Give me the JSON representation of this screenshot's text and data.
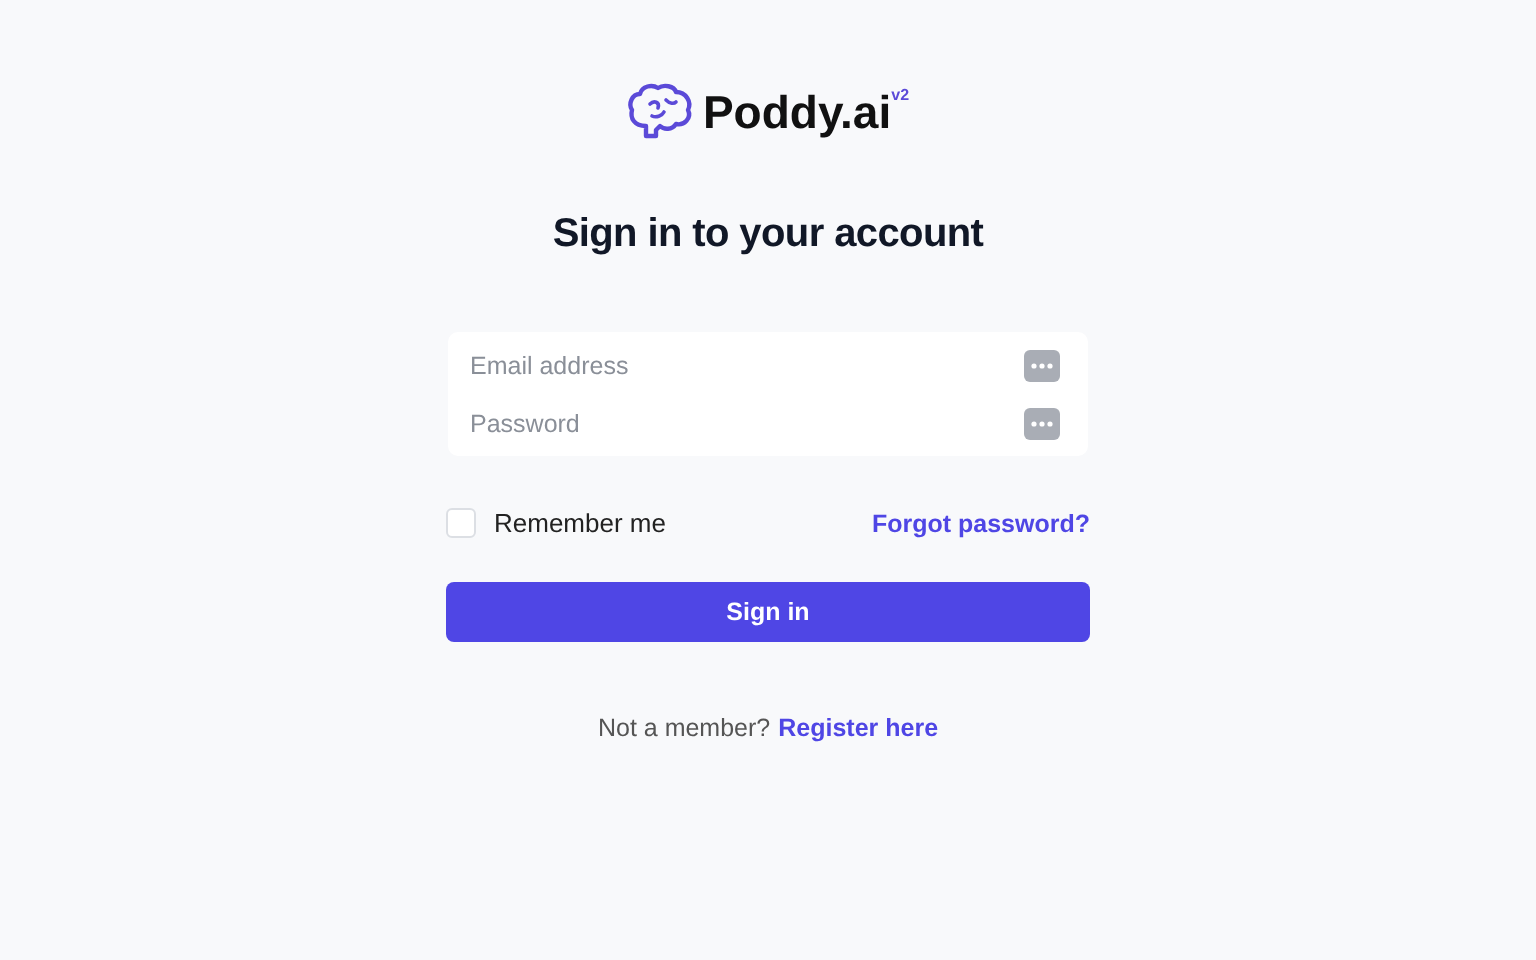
{
  "logo": {
    "text": "Poddy.ai$^{v2}$"
  },
  "heading": "Sign in to your account",
  "fields": [
    {
      "placeholder": "Email address"
    },
    {
      "placeholder": "Password"
    }
  ],
  "remember": {
    "label": "Remember me",
    "checked": false
  },
  "forgot_link": "Forgot password?",
  "submit": "Sign in",
  "footer": {
    "text": "Not a member?",
    "link": "Register here"
  }
}
